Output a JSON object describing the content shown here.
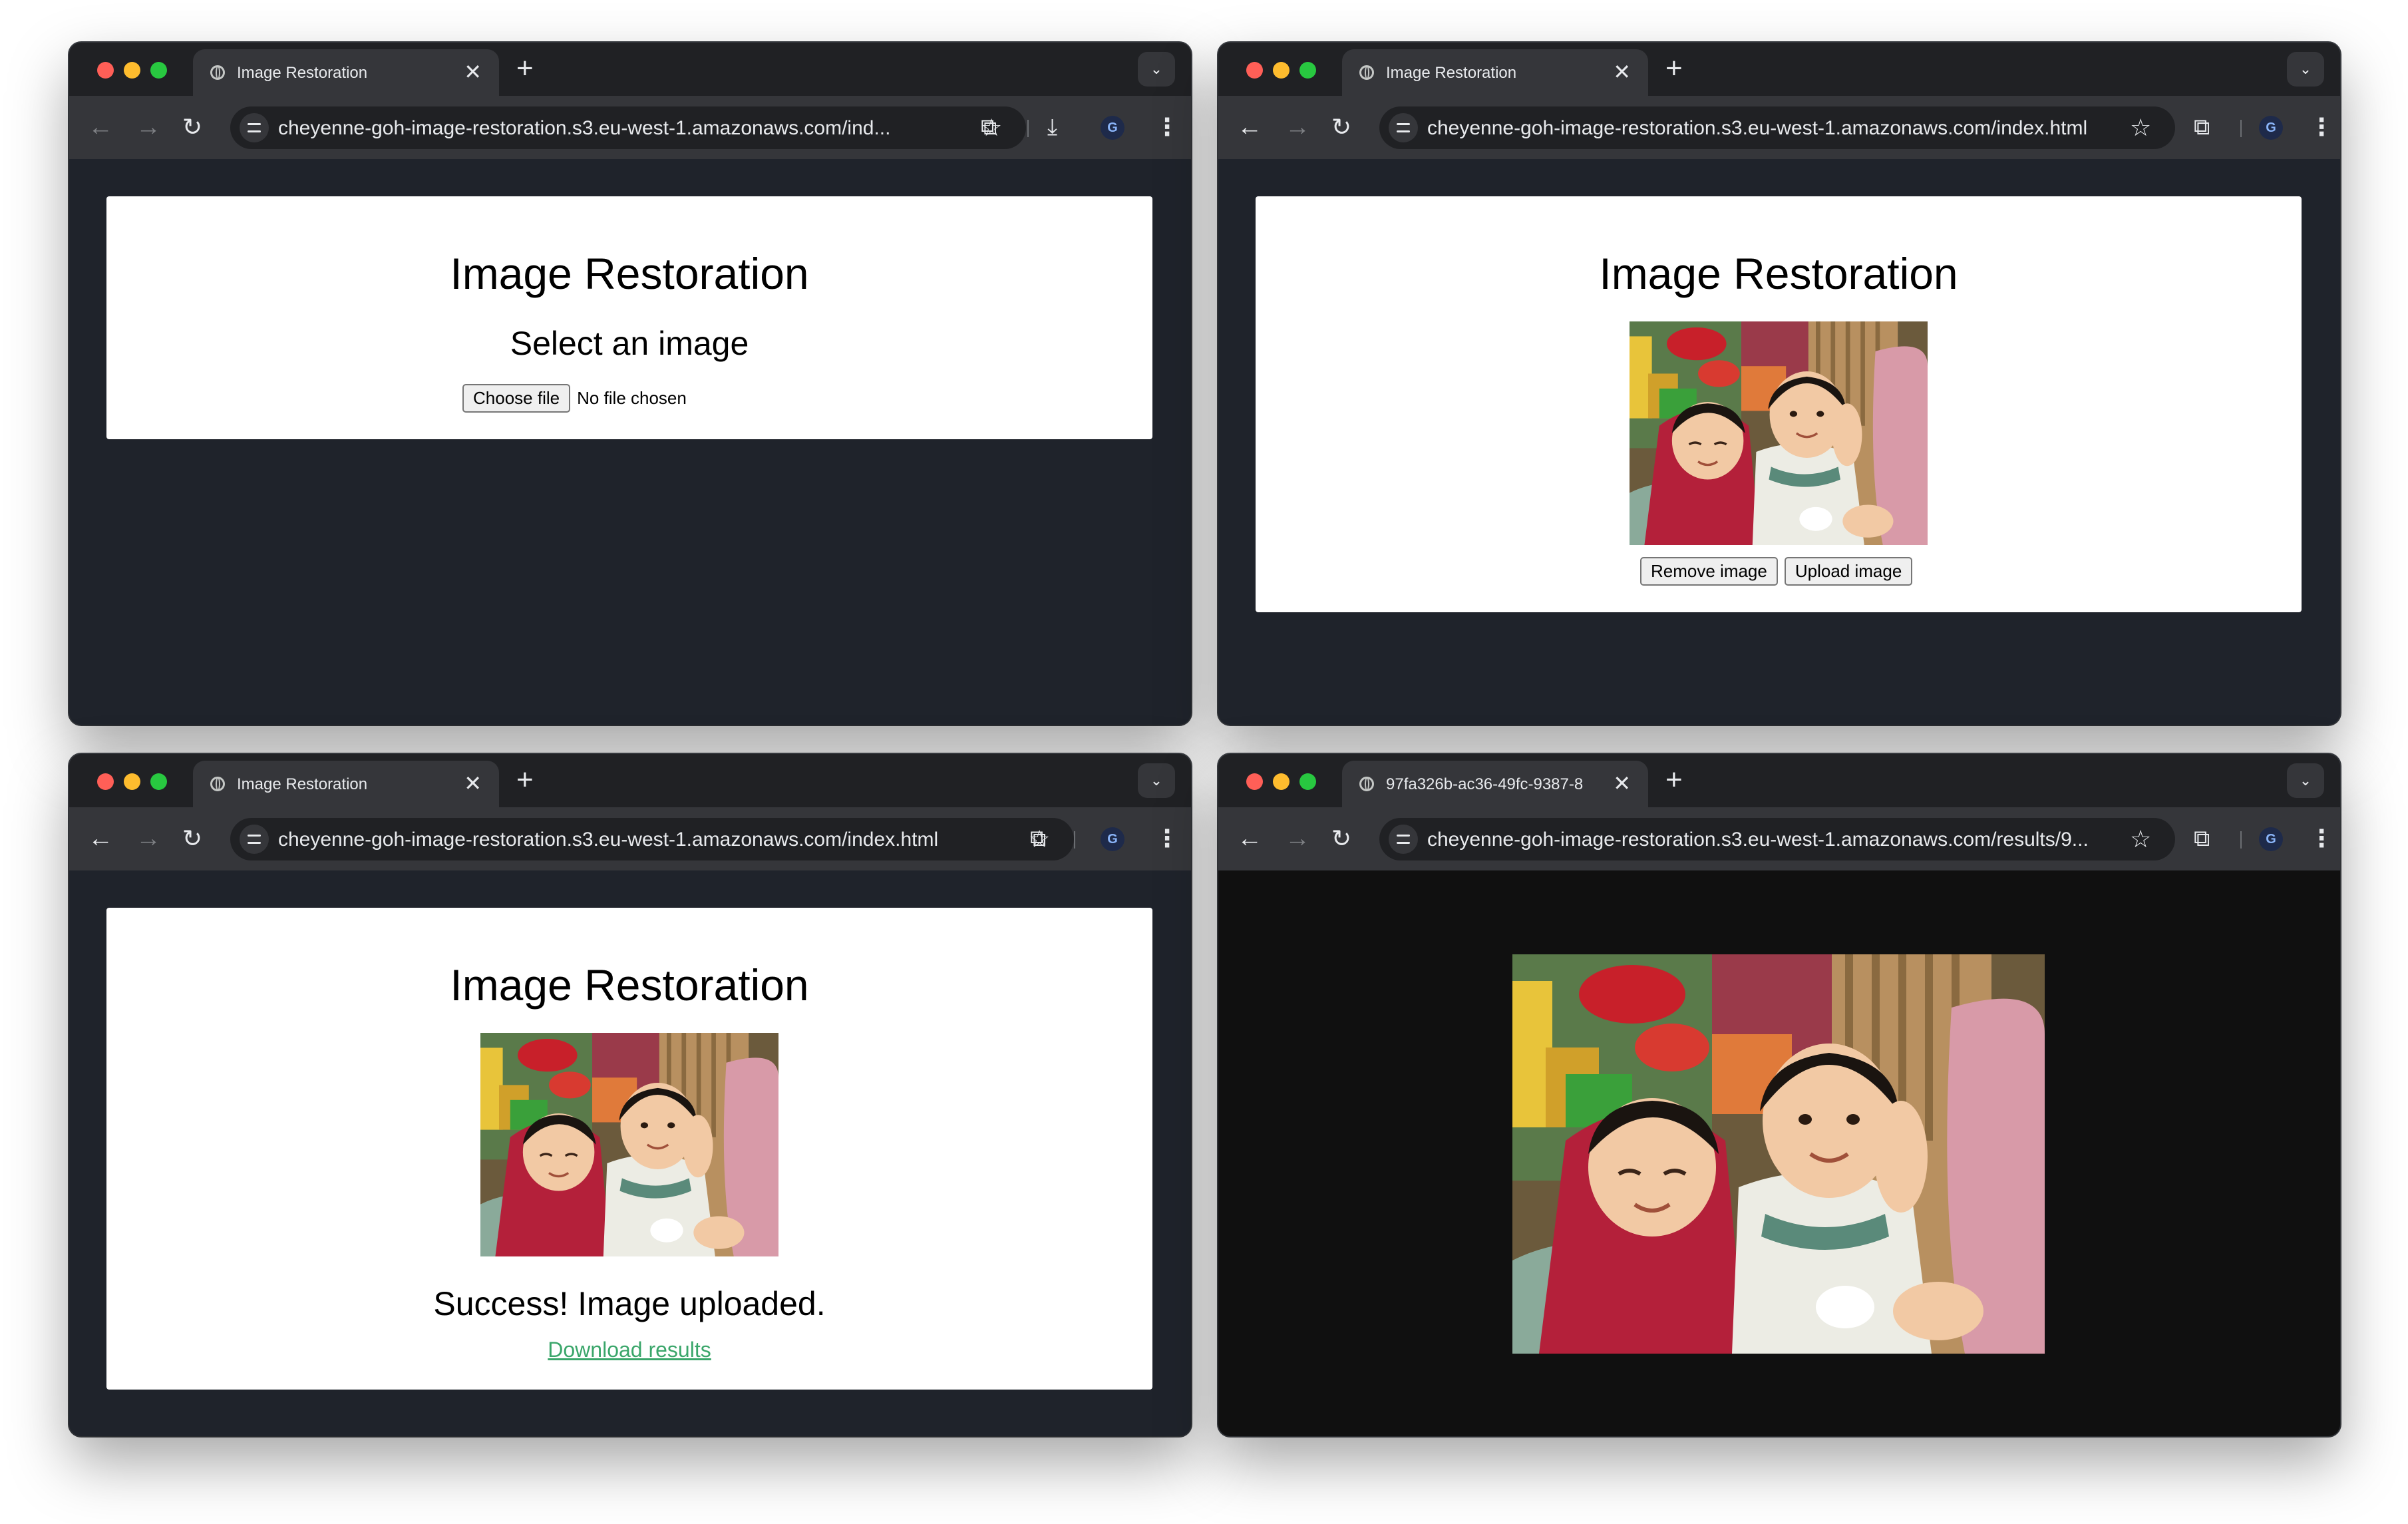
{
  "photo_alt": "Photo of two smiling children",
  "windows": [
    {
      "tab_title": "Image Restoration",
      "url": "cheyenne-goh-image-restoration.s3.eu-west-1.amazonaws.com/ind...",
      "page_title": "Image Restoration",
      "subtitle": "Select an image",
      "choose_file_label": "Choose file",
      "no_file_text": "No file chosen"
    },
    {
      "tab_title": "Image Restoration",
      "url": "cheyenne-goh-image-restoration.s3.eu-west-1.amazonaws.com/index.html",
      "page_title": "Image Restoration",
      "remove_label": "Remove image",
      "upload_label": "Upload image"
    },
    {
      "tab_title": "Image Restoration",
      "url": "cheyenne-goh-image-restoration.s3.eu-west-1.amazonaws.com/index.html",
      "page_title": "Image Restoration",
      "success_text": "Success! Image uploaded.",
      "download_label": "Download results"
    },
    {
      "tab_title": "97fa326b-ac36-49fc-9387-8",
      "url": "cheyenne-goh-image-restoration.s3.eu-west-1.amazonaws.com/results/9..."
    }
  ],
  "colors": {
    "window_bg": "#1f232b",
    "result_bg": "#101010",
    "link": "#3aa66a",
    "traffic_red": "#ff5f57",
    "traffic_yellow": "#febc2e",
    "traffic_green": "#28c840"
  },
  "icons": [
    "globe-icon",
    "close-icon",
    "plus-icon",
    "chevron-down-icon",
    "back-icon",
    "forward-icon",
    "reload-icon",
    "tune-icon",
    "star-icon",
    "extensions-icon",
    "download-icon",
    "profile-icon",
    "kebab-icon"
  ]
}
